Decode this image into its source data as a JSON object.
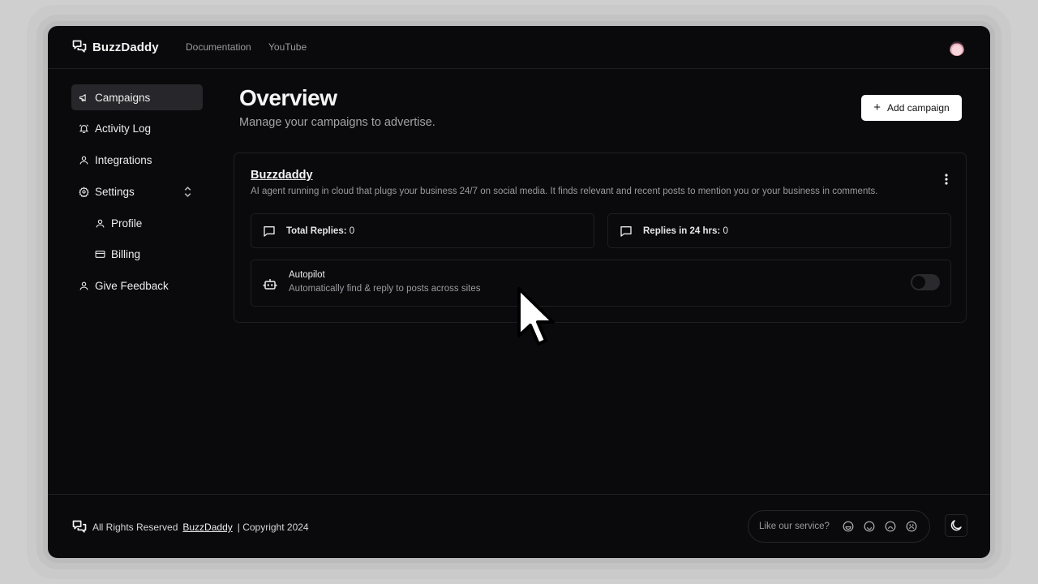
{
  "header": {
    "brand": "BuzzDaddy",
    "nav": [
      {
        "label": "Documentation"
      },
      {
        "label": "YouTube"
      }
    ]
  },
  "sidebar": {
    "items": [
      {
        "label": "Campaigns",
        "icon": "megaphone-icon",
        "active": true
      },
      {
        "label": "Activity Log",
        "icon": "bell-icon"
      },
      {
        "label": "Integrations",
        "icon": "user-icon"
      },
      {
        "label": "Settings",
        "icon": "gear-icon",
        "expanded": true
      },
      {
        "label": "Profile",
        "icon": "user-icon"
      },
      {
        "label": "Billing",
        "icon": "credit-card-icon"
      },
      {
        "label": "Give Feedback",
        "icon": "user-icon"
      }
    ]
  },
  "main": {
    "title": "Overview",
    "subtitle": "Manage your campaigns to advertise.",
    "add_button": "Add campaign",
    "campaign": {
      "name": "Buzzdaddy",
      "description": "AI agent running in cloud that plugs your business 24/7 on social media. It finds relevant and recent posts to mention you or your business in comments.",
      "stats": [
        {
          "label": "Total Replies:",
          "value": "0"
        },
        {
          "label": "Replies in 24 hrs:",
          "value": "0"
        }
      ],
      "autopilot": {
        "title": "Autopilot",
        "description": "Automatically find & reply to posts across sites",
        "enabled": false
      }
    }
  },
  "footer": {
    "prefix": "All Rights Reserved",
    "brand_link": "BuzzDaddy",
    "suffix": "| Copyright 2024",
    "rating_prompt": "Like our service?"
  },
  "colors": {
    "background": "#0a0a0c",
    "border": "#1f1f23",
    "active_item": "#27272b",
    "primary_button": "#ffffff"
  }
}
